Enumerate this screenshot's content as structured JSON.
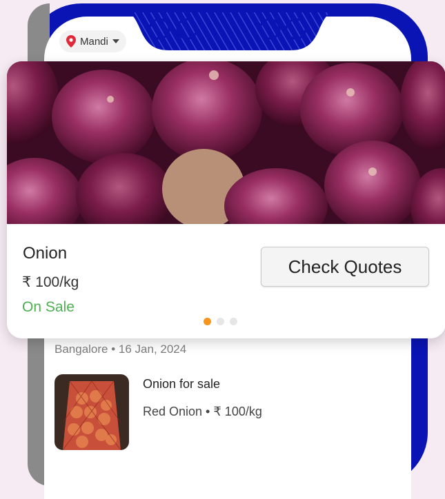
{
  "header": {
    "location_label": "Mandi",
    "location_icon": "location-pin-icon",
    "dropdown_icon": "chevron-down-icon"
  },
  "featured": {
    "name": "Onion",
    "price": "₹ 100/kg",
    "status": "On Sale",
    "button_label": "Check Quotes",
    "carousel_total": 3,
    "carousel_active": 0
  },
  "listing": {
    "meta": "Bangalore • 16 Jan, 2024",
    "title": "Onion for sale",
    "subtitle": "Red Onion  •  ₹ 100/kg"
  },
  "colors": {
    "frame": "#0a14b4",
    "accent_dot": "#f7941d",
    "status_green": "#4caf50",
    "background": "#f7ebf3"
  }
}
